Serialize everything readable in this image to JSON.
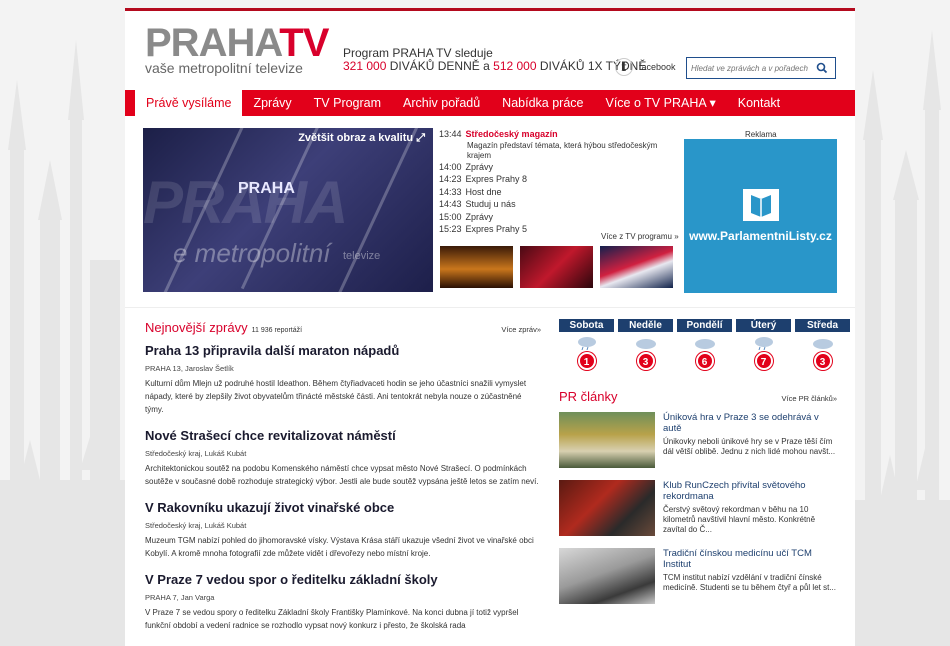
{
  "logo": {
    "prefix": "PRAHA",
    "suffix": "TV",
    "tagline": "vaše metropolitní televize"
  },
  "promo": {
    "line1": "Program PRAHA TV sleduje",
    "daily_count": "321 000",
    "daily_text": "DIVÁKŮ DENNĚ",
    "joiner": "a",
    "weekly_count": "512 000",
    "weekly_text": "DIVÁKŮ 1X TÝDNĚ"
  },
  "facebook": {
    "label": "facebook"
  },
  "search": {
    "placeholder": "Hledat ve zprávách a v pořadech"
  },
  "nav": [
    {
      "label": "Právě vysíláme"
    },
    {
      "label": "Zprávy"
    },
    {
      "label": "TV Program"
    },
    {
      "label": "Archiv pořadů"
    },
    {
      "label": "Nabídka práce"
    },
    {
      "label": "Více o TV PRAHA ▾"
    },
    {
      "label": "Kontakt"
    }
  ],
  "hero": {
    "enlarge_label": "Zvětšit obraz a kvalitu",
    "bg_big": "PRAHA",
    "bg_mid": "PRAHA",
    "bg_sub": "e metropolitní",
    "bg_sub2": "televize"
  },
  "schedule": [
    {
      "time": "13:44",
      "title": "Středočeský magazín",
      "desc": "Magazín představí témata, která hýbou středočeským krajem"
    },
    {
      "time": "14:00",
      "title": "Zprávy"
    },
    {
      "time": "14:23",
      "title": "Expres Prahy 8"
    },
    {
      "time": "14:33",
      "title": "Host dne"
    },
    {
      "time": "14:43",
      "title": "Studuj u nás"
    },
    {
      "time": "15:00",
      "title": "Zprávy"
    },
    {
      "time": "15:23",
      "title": "Expres Prahy 5"
    }
  ],
  "schedule_more": "Více z TV programu »",
  "ad": {
    "label": "Reklama",
    "text": "www.ParlamentniListy.cz"
  },
  "news": {
    "title": "Nejnovější zprávy",
    "count": "11 936 reportáží",
    "more": "Více zpráv»",
    "articles": [
      {
        "title": "Praha 13 připravila další maraton nápadů",
        "meta": "PRAHA 13, Jaroslav Šetlík",
        "text": "Kulturní dům Mlejn už podruhé hostil Ideathon. Během čtyřiadvaceti hodin se jeho účastníci snažili vymyslet nápady, které by zlepšily život obyvatelům třinácté městské části. Ani tentokrát nebyla nouze o zúčastněné týmy."
      },
      {
        "title": "Nové Strašecí chce revitalizovat náměstí",
        "meta": "Středočeský kraj, Lukáš Kubát",
        "text": "Architektonickou soutěž na podobu Komenského náměstí chce vypsat město Nové Strašecí. O podmínkách soutěže v současné době rozhoduje strategický výbor. Jestli ale bude soutěž vypsána ještě letos se zatím neví."
      },
      {
        "title": "V Rakovníku ukazují život vinařské obce",
        "meta": "Středočeský kraj, Lukáš Kubát",
        "text": "Muzeum TGM nabízí pohled do jihomoravské vísky. Výstava Krása stáří ukazuje všední život ve vinařské obci Kobylí. A kromě mnoha fotografií zde můžete vidět i dřevořezy nebo místní kroje."
      },
      {
        "title": "V Praze 7 vedou spor o ředitelku základní školy",
        "meta": "PRAHA 7, Jan Varga",
        "text": "V Praze 7 se vedou spory o ředitelku Základní školy Františky Plamínkové. Na konci dubna jí totiž vypršel funkční období a vedení radnice se rozhodlo vypsat nový konkurz i přesto, že školská rada"
      }
    ]
  },
  "weather": [
    {
      "day": "Sobota",
      "num": "1"
    },
    {
      "day": "Neděle",
      "num": "3"
    },
    {
      "day": "Pondělí",
      "num": "6"
    },
    {
      "day": "Úterý",
      "num": "7"
    },
    {
      "day": "Středa",
      "num": "3"
    }
  ],
  "pr": {
    "title": "PR články",
    "more": "Více PR článků»",
    "items": [
      {
        "title": "Úniková hra v Praze 3 se odehrává v autě",
        "text": "Únikovky neboli únikové hry se v Praze těší čím dál větší oblibě. Jednu z nich lidé mohou navšt..."
      },
      {
        "title": "Klub RunCzech přivítal světového rekordmana",
        "text": "Čerstvý světový rekordman v běhu na 10 kilometrů navštívil hlavní město. Konkrétně zavítal do Č..."
      },
      {
        "title": "Tradiční čínskou medicínu učí TCM Institut",
        "text": "TCM institut nabízí vzdělání v tradiční čínské medicíně. Studenti se tu během čtyř a půl let st..."
      }
    ]
  }
}
